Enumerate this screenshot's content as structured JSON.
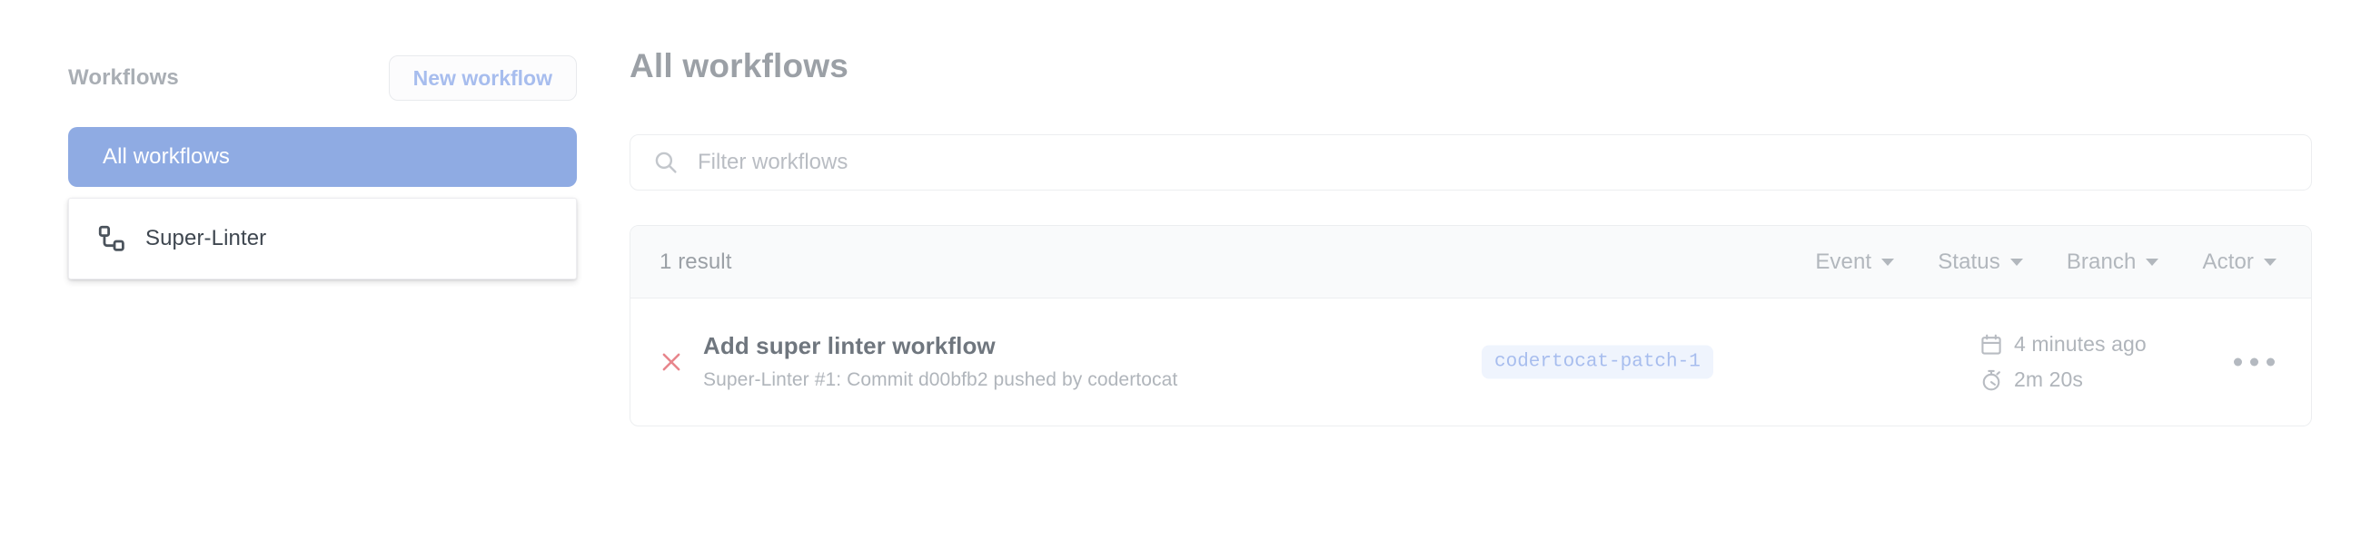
{
  "sidebar": {
    "title": "Workflows",
    "new_workflow_label": "New workflow",
    "items": [
      {
        "label": "All workflows",
        "icon": "none",
        "selected": true
      },
      {
        "label": "Super-Linter",
        "icon": "workflow-icon",
        "selected": false
      }
    ]
  },
  "main": {
    "title": "All workflows",
    "search": {
      "placeholder": "Filter workflows",
      "value": "",
      "icon": "search-icon"
    },
    "results_header": {
      "count_label": "1 result",
      "filters": [
        {
          "label": "Event",
          "icon": "chevron-down-icon"
        },
        {
          "label": "Status",
          "icon": "chevron-down-icon"
        },
        {
          "label": "Branch",
          "icon": "chevron-down-icon"
        },
        {
          "label": "Actor",
          "icon": "chevron-down-icon"
        }
      ]
    },
    "runs": [
      {
        "status": "failure",
        "status_icon": "x-icon",
        "title": "Add super linter workflow",
        "subtitle": "Super-Linter #1: Commit d00bfb2 pushed by codertocat",
        "branch": "codertocat-patch-1",
        "timestamp": "4 minutes ago",
        "timestamp_icon": "calendar-icon",
        "duration": "2m 20s",
        "duration_icon": "stopwatch-icon",
        "menu_icon": "kebab-icon"
      }
    ]
  },
  "colors": {
    "selected_blue": "#8fabe3",
    "link_blue": "#a7bdee",
    "badge_bg": "#eff4fd",
    "failure_red": "#e8858c",
    "text_gray": "#9ba0a6",
    "border_gray": "#eceef0",
    "header_bg": "#f9fafb"
  }
}
